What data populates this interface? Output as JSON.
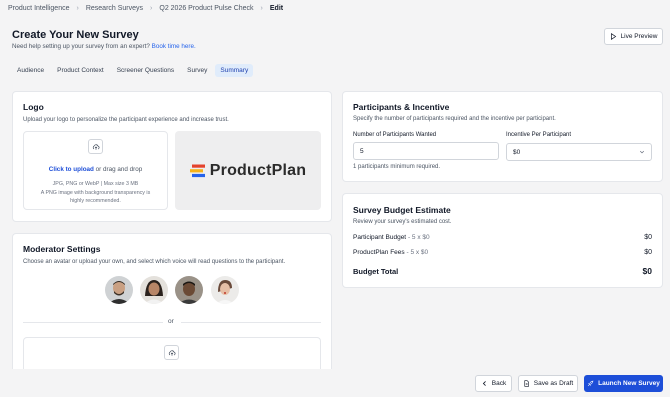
{
  "breadcrumb": {
    "items": [
      "Product Intelligence",
      "Research Surveys",
      "Q2 2026 Product Pulse Check",
      "Edit"
    ]
  },
  "header": {
    "title": "Create Your New Survey",
    "help_text": "Need help setting up your survey from an expert?",
    "help_link": "Book time here.",
    "live_preview": "Live Preview"
  },
  "tabs": [
    "Audience",
    "Product Context",
    "Screener Questions",
    "Survey",
    "Summary"
  ],
  "logo_card": {
    "title": "Logo",
    "subtitle": "Upload your logo to personalize the participant experience and increase trust.",
    "upload_link": "Click to upload",
    "upload_rest": "or drag and drop",
    "formats": "JPG, PNG or WebP | Max size 3 MB",
    "hint": "A PNG image with background transparency is highly recommended.",
    "brand_name": "ProductPlan"
  },
  "moderator_card": {
    "title": "Moderator Settings",
    "subtitle": "Choose an avatar or upload your own, and select which voice will read questions to the participant.",
    "divider": "or"
  },
  "participants_card": {
    "title": "Participants & Incentive",
    "subtitle": "Specify the number of participants required and the incentive per participant.",
    "count_label": "Number of Participants Wanted",
    "count_value": "5",
    "incentive_label": "Incentive Per Participant",
    "incentive_value": "$0",
    "min_note": "1 participants minimum required."
  },
  "budget_card": {
    "title": "Survey Budget Estimate",
    "subtitle": "Review your survey's estimated cost.",
    "rows": [
      {
        "label": "Participant Budget",
        "detail": "- 5 x $0",
        "value": "$0"
      },
      {
        "label": "ProductPlan Fees",
        "detail": "- 5 x $0",
        "value": "$0"
      }
    ],
    "total_label": "Budget Total",
    "total_value": "$0"
  },
  "footer": {
    "back": "Back",
    "save_draft": "Save as Draft",
    "launch": "Launch New Survey"
  },
  "colors": {
    "accent": "#1d4ed8",
    "link": "#2563eb",
    "active_tab_bg": "#e0ecfb",
    "logo_bar_red": "#e4432d",
    "logo_bar_yellow": "#f5b21a",
    "logo_bar_blue": "#2563eb"
  }
}
